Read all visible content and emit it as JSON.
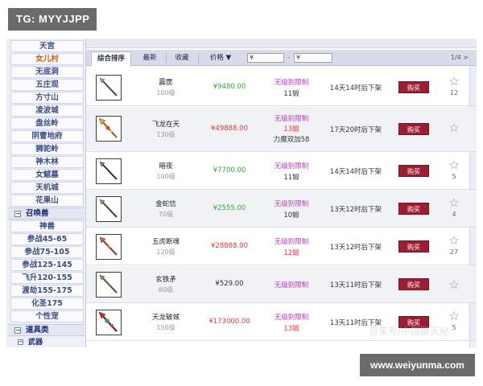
{
  "watermark": {
    "top_left": "TG: MYYJJPP",
    "bottom_right": "www.weiyunma.com",
    "ghost": "百家号/中国聊天秘"
  },
  "sidebar": {
    "items": [
      "天宫",
      "女儿村",
      "无底洞",
      "五庄观",
      "方寸山",
      "凌波城",
      "盘丝岭",
      "阴曹地府",
      "狮驼岭",
      "神木林",
      "女魃墓",
      "天机城",
      "花果山"
    ],
    "active_index": 1,
    "group_summons": {
      "toggle": "−",
      "label": "召唤兽"
    },
    "summon_items": [
      "神兽",
      "参战45-65",
      "参战75-105",
      "参战125-145",
      "飞升120-155",
      "渡劫155-175",
      "化圣175",
      "个性宠"
    ],
    "group_items": {
      "toggle": "−",
      "label": "道具类"
    },
    "sub_weapons": {
      "toggle": "−",
      "label": "武器"
    }
  },
  "toolbar": {
    "sort_all": "综合排序",
    "newest": "最新",
    "favorite": "收藏",
    "price": "价格 ▼",
    "price_min": "¥",
    "price_max": "¥",
    "dash": "-",
    "pager": "1/4 >"
  },
  "listings": [
    {
      "name": "霹雳",
      "level": "100级",
      "price": "¥9480.00",
      "price_color": "green",
      "limit1": "无级别限制",
      "limit2": "11锻",
      "limit2_color": "dark",
      "limit3": "",
      "time": "14天14时后下架",
      "buy": "购买",
      "favs": "12"
    },
    {
      "name": "飞龙在天",
      "level": "130级",
      "price": "¥49888.00",
      "price_color": "red",
      "limit1": "无级别限制",
      "limit2": "13锻",
      "limit2_color": "red",
      "limit3": "力魔双加58",
      "time": "17天20时后下架",
      "buy": "购买",
      "favs": ""
    },
    {
      "name": "暗夜",
      "level": "100级",
      "price": "¥7700.00",
      "price_color": "green",
      "limit1": "无级别限制",
      "limit2": "11锻",
      "limit2_color": "dark",
      "limit3": "",
      "time": "14天14时后下架",
      "buy": "购买",
      "favs": "5"
    },
    {
      "name": "金蛇信",
      "level": "70级",
      "price": "¥2555.00",
      "price_color": "green",
      "limit1": "无级别限制",
      "limit2": "10锻",
      "limit2_color": "dark",
      "limit3": "",
      "time": "13天12时后下架",
      "buy": "购买",
      "favs": "4"
    },
    {
      "name": "五虎断魂",
      "level": "120级",
      "price": "¥28888.00",
      "price_color": "red",
      "limit1": "无级别限制",
      "limit2": "12锻",
      "limit2_color": "red",
      "limit3": "",
      "time": "13天12时后下架",
      "buy": "购买",
      "favs": "27"
    },
    {
      "name": "玄铁矛",
      "level": "60级",
      "price": "¥529.00",
      "price_color": "dark",
      "limit1": "无级别限制",
      "limit2": "",
      "limit2_color": "dark",
      "limit3": "",
      "time": "13天11时后下架",
      "buy": "购买",
      "favs": ""
    },
    {
      "name": "天龙破城",
      "level": "150级",
      "price": "¥173000.00",
      "price_color": "red",
      "limit1": "无级别限制",
      "limit2": "13锻",
      "limit2_color": "red",
      "limit3": "",
      "time": "13天11时后下架",
      "buy": "购买",
      "favs": "5"
    }
  ],
  "colors": {
    "buy_button": "#9c1e33",
    "price_green": "#38a43a",
    "price_red": "#e23b3b",
    "limit_purple": "#c23bbf",
    "sidebar_active": "#d45a00"
  },
  "icons": {
    "favorite": "star-outline-icon",
    "weapon": "spear-icon"
  }
}
